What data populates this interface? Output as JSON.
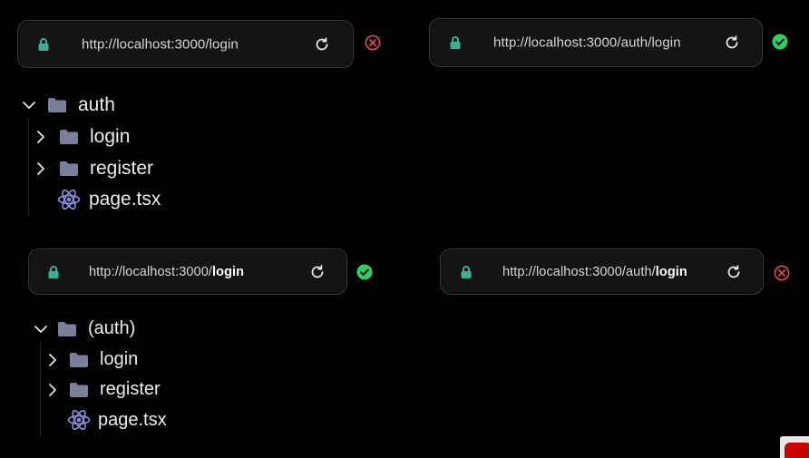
{
  "panels": [
    {
      "id": "top-left",
      "url_plain": "http://localhost:3000/login",
      "url_bold": "",
      "status": "error",
      "tree": [
        {
          "type": "folder",
          "label": "auth",
          "expanded": true
        },
        {
          "type": "folder",
          "label": "login",
          "expanded": false
        },
        {
          "type": "folder",
          "label": "register",
          "expanded": false
        },
        {
          "type": "file",
          "label": "page.tsx",
          "icon": "react-icon"
        }
      ]
    },
    {
      "id": "top-right",
      "url_plain": "http://localhost:3000/auth/login",
      "url_bold": "",
      "status": "success"
    },
    {
      "id": "bottom-left",
      "url_plain": "http://localhost:3000/",
      "url_bold": "login",
      "status": "success",
      "tree": [
        {
          "type": "folder",
          "label": "(auth)",
          "expanded": true
        },
        {
          "type": "folder",
          "label": "login",
          "expanded": false
        },
        {
          "type": "folder",
          "label": "register",
          "expanded": false
        },
        {
          "type": "file",
          "label": "page.tsx",
          "icon": "react-icon"
        }
      ]
    },
    {
      "id": "bottom-right",
      "url_plain": "http://localhost:3000/auth/",
      "url_bold": "login",
      "status": "error"
    }
  ],
  "colors": {
    "background": "#000000",
    "urlbar": "#141414",
    "lock": "#3fb08f",
    "success": "#33cc66",
    "error": "#e5484d",
    "folder": "#7a7f9a",
    "react": "#8b8fe0"
  },
  "icons": {
    "lock": "lock-icon",
    "reload": "reload-icon",
    "success": "check-circle-icon",
    "error": "x-circle-icon",
    "folder": "folder-icon",
    "chevron_down": "chevron-down-icon",
    "chevron_right": "chevron-right-icon",
    "react": "react-icon"
  }
}
